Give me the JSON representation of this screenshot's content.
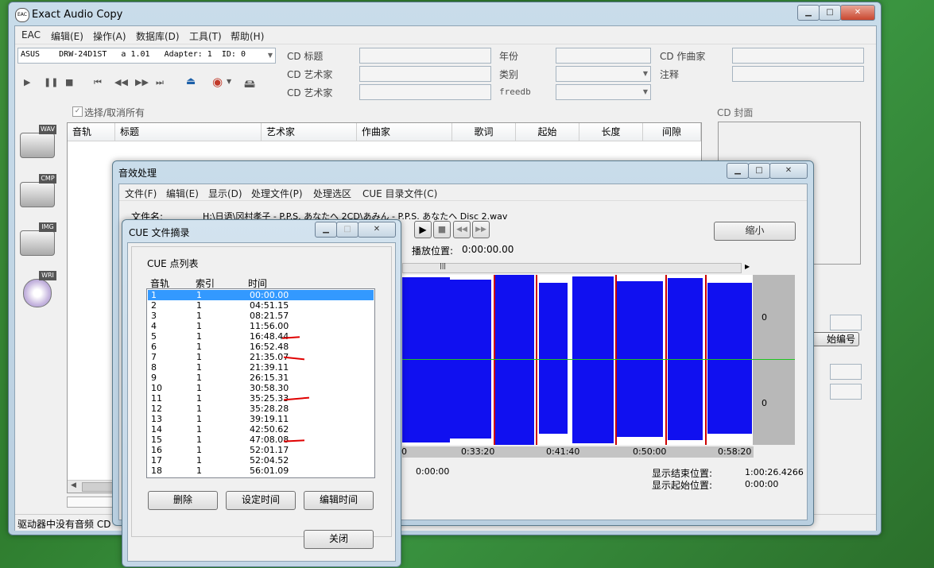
{
  "main": {
    "title": "Exact Audio Copy",
    "menu": [
      "EAC",
      "编辑(E)",
      "操作(A)",
      "数据库(D)",
      "工具(T)",
      "帮助(H)"
    ],
    "drive": "ASUS    DRW-24D1ST   a 1.01   Adapter: 1  ID: 0",
    "labels": {
      "cd_title": "CD 标题",
      "cd_artist": "CD 艺术家",
      "cd_artist2": "CD 艺术家",
      "year": "年份",
      "genre": "类别",
      "freedb": "freedb",
      "cd_composer": "CD 作曲家",
      "comment": "注释",
      "cd_cover": "CD 封面"
    },
    "select_all": "选择/取消所有",
    "columns": [
      "音轨",
      "标题",
      "艺术家",
      "作曲家",
      "歌词",
      "起始",
      "长度",
      "间隙"
    ],
    "side_icons": [
      "WAV",
      "CMP",
      "IMG",
      "WRI"
    ],
    "status": "驱动器中没有音频 CD",
    "right_partial": "始编号"
  },
  "audio": {
    "title": "音效处理",
    "menu": [
      "文件(F)",
      "编辑(E)",
      "显示(D)",
      "处理文件(P)",
      "处理选区",
      "CUE 目录文件(C)"
    ],
    "filename_label": "文件名:",
    "filename": "H:\\日语\\冈村孝子 - P.P.S. あなたへ  2CD\\あみん - P.P.S. あなたへ Disc 2.wav",
    "play_pos_label": "播放位置:",
    "play_pos": "0:00:00.00",
    "shrink": "缩小",
    "axis": [
      "0",
      "0:33:20",
      "0:41:40",
      "0:50:00",
      "0:58:20"
    ],
    "level_labels": [
      "0",
      "0"
    ],
    "pos1": "0:00:00",
    "end_label": "显示结束位置:",
    "end_val": "1:00:26.4266",
    "start_label": "显示起始位置:",
    "start_val": "0:00:00"
  },
  "cue": {
    "title": "CUE 文件摘录",
    "list_title": "CUE 点列表",
    "headers": [
      "音轨",
      "索引",
      "时间"
    ],
    "rows": [
      [
        "1",
        "1",
        "00:00.00"
      ],
      [
        "2",
        "1",
        "04:51.15"
      ],
      [
        "3",
        "1",
        "08:21.57"
      ],
      [
        "4",
        "1",
        "11:56.00"
      ],
      [
        "5",
        "1",
        "16:48.44"
      ],
      [
        "6",
        "1",
        "16:52.48"
      ],
      [
        "7",
        "1",
        "21:35.07"
      ],
      [
        "8",
        "1",
        "21:39.11"
      ],
      [
        "9",
        "1",
        "26:15.31"
      ],
      [
        "10",
        "1",
        "30:58.30"
      ],
      [
        "11",
        "1",
        "35:25.33"
      ],
      [
        "12",
        "1",
        "35:28.28"
      ],
      [
        "13",
        "1",
        "39:19.11"
      ],
      [
        "14",
        "1",
        "42:50.62"
      ],
      [
        "15",
        "1",
        "47:08.08"
      ],
      [
        "16",
        "1",
        "52:01.17"
      ],
      [
        "17",
        "1",
        "52:04.52"
      ],
      [
        "18",
        "1",
        "56:01.09"
      ]
    ],
    "buttons": {
      "delete": "删除",
      "set_time": "设定时间",
      "edit_time": "编辑时间",
      "close": "关闭"
    }
  },
  "colors": {
    "selection": "#3399ff",
    "wave": "#1010f0",
    "marker": "#cc0000",
    "annotation": "#e00000"
  }
}
